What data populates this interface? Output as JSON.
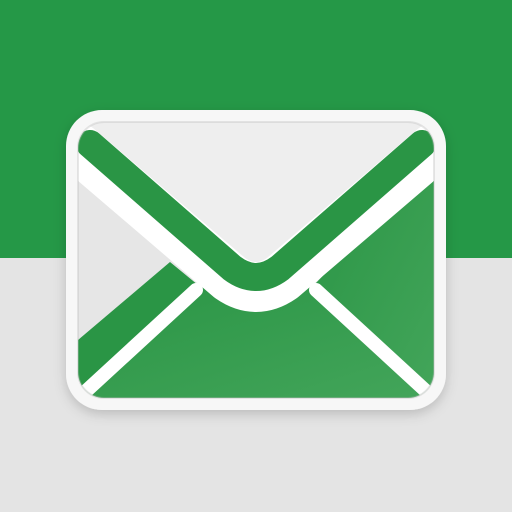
{
  "icon": {
    "name": "mail-envelope-icon"
  },
  "colors": {
    "background_top": "#259847",
    "background_bottom": "#e4e4e4",
    "envelope_frame": "#f7f7f7",
    "envelope_paper": "#eeeeee",
    "envelope_side": "#e6e6e6",
    "envelope_green": "#2a9545",
    "envelope_green_light": "#43a55a",
    "envelope_fold": "#ffffff"
  }
}
